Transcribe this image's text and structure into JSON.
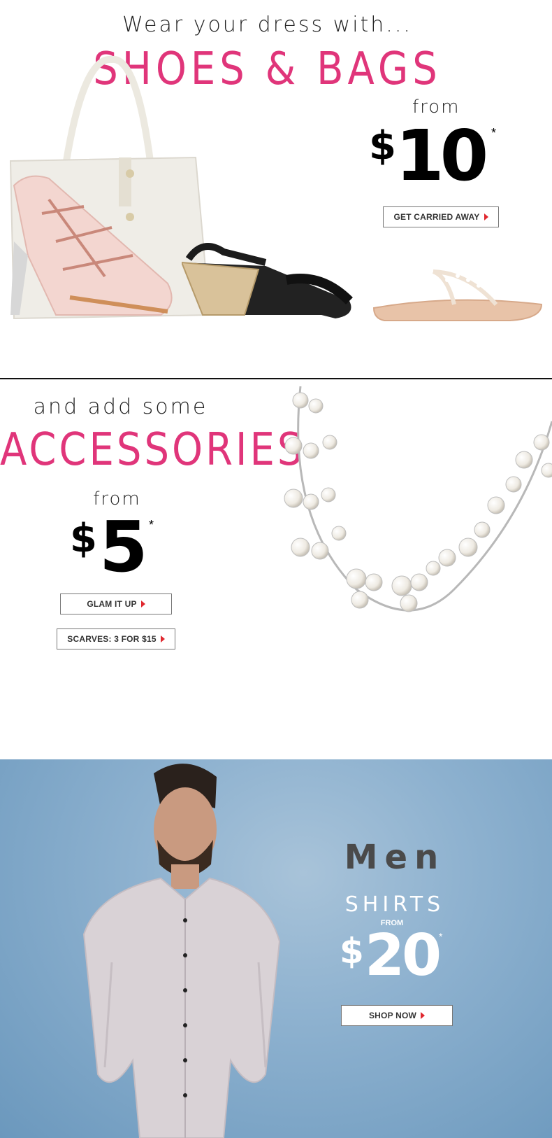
{
  "shoes_section": {
    "intro": "Wear your dress with...",
    "headline": "SHOES & BAGS",
    "from_label": "from",
    "price_symbol": "$",
    "price_value": "10",
    "asterisk": "*",
    "cta_label": "GET CARRIED AWAY"
  },
  "accessories_section": {
    "intro": "and add some",
    "headline": "ACCESSORIES",
    "from_label": "from",
    "price_symbol": "$",
    "price_value": "5",
    "asterisk": "*",
    "cta_label": "GLAM IT UP",
    "cta2_label": "SCARVES: 3 FOR $15"
  },
  "men_section": {
    "headline": "Men",
    "subhead": "SHIRTS",
    "from_label": "FROM",
    "price_symbol": "$",
    "price_value": "20",
    "asterisk": "*",
    "cta_label": "SHOP NOW"
  },
  "colors": {
    "accent_pink": "#e0357a",
    "arrow_red": "#e0282f",
    "men_bg": "#8db1cf"
  }
}
